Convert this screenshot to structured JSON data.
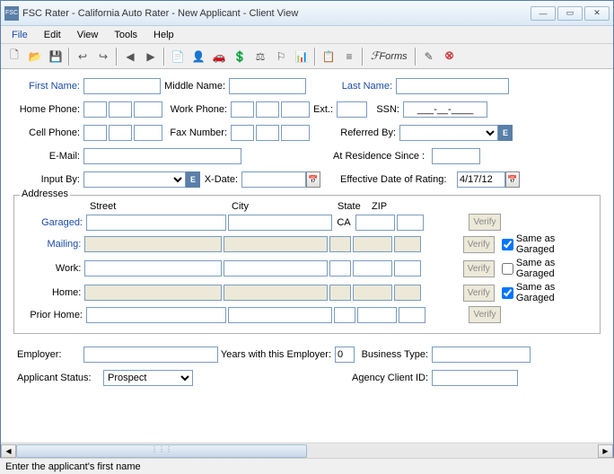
{
  "window": {
    "title": "FSC Rater - California Auto Rater - New Applicant - Client View",
    "icon_text": "FSC"
  },
  "menu": {
    "file": "File",
    "edit": "Edit",
    "view": "View",
    "tools": "Tools",
    "help": "Help"
  },
  "toolbar": {
    "forms": "Forms"
  },
  "labels": {
    "first_name": "First Name:",
    "middle_name": "Middle Name:",
    "last_name": "Last Name:",
    "home_phone": "Home Phone:",
    "work_phone": "Work Phone:",
    "ext": "Ext.:",
    "ssn": "SSN:",
    "cell_phone": "Cell Phone:",
    "fax_number": "Fax Number:",
    "referred_by": "Referred By:",
    "email": "E-Mail:",
    "at_residence": "At Residence Since :",
    "input_by": "Input By:",
    "xdate": "X-Date:",
    "eff_date": "Effective Date of Rating:",
    "addresses": "Addresses",
    "street": "Street",
    "city": "City",
    "state": "State",
    "zip": "ZIP",
    "garaged": "Garaged:",
    "mailing": "Mailing:",
    "work": "Work:",
    "home": "Home:",
    "prior_home": "Prior Home:",
    "verify": "Verify",
    "same_garaged": "Same as Garaged",
    "employer": "Employer:",
    "years_emp": "Years with this Employer:",
    "business_type": "Business Type:",
    "applicant_status": "Applicant Status:",
    "agency_client": "Agency Client ID:"
  },
  "values": {
    "ssn_mask": "___-__-____",
    "eff_date": "4/17/12",
    "years_emp": "0",
    "applicant_status": "Prospect",
    "garaged_state": "CA",
    "e_btn": "E"
  },
  "checks": {
    "mailing": true,
    "work": false,
    "home": true
  },
  "status": "Enter the applicant's first name"
}
